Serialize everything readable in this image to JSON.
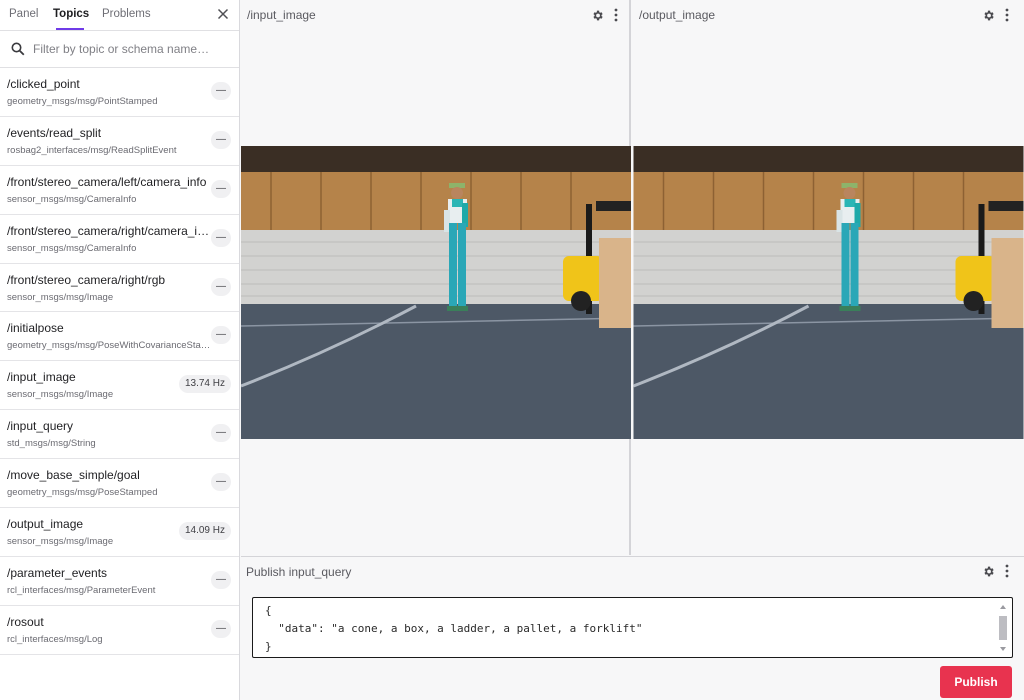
{
  "sidebar": {
    "tabs": [
      {
        "label": "Panel"
      },
      {
        "label": "Topics"
      },
      {
        "label": "Problems"
      }
    ],
    "filter_placeholder": "Filter by topic or schema name…",
    "topics": [
      {
        "name": "/clicked_point",
        "schema": "geometry_msgs/msg/PointStamped",
        "freq": "—"
      },
      {
        "name": "/events/read_split",
        "schema": "rosbag2_interfaces/msg/ReadSplitEvent",
        "freq": "—"
      },
      {
        "name": "/front/stereo_camera/left/camera_info",
        "schema": "sensor_msgs/msg/CameraInfo",
        "freq": "—"
      },
      {
        "name": "/front/stereo_camera/right/camera_info",
        "schema": "sensor_msgs/msg/CameraInfo",
        "freq": "—"
      },
      {
        "name": "/front/stereo_camera/right/rgb",
        "schema": "sensor_msgs/msg/Image",
        "freq": "—"
      },
      {
        "name": "/initialpose",
        "schema": "geometry_msgs/msg/PoseWithCovarianceStamped",
        "freq": "—"
      },
      {
        "name": "/input_image",
        "schema": "sensor_msgs/msg/Image",
        "freq": "13.74 Hz"
      },
      {
        "name": "/input_query",
        "schema": "std_msgs/msg/String",
        "freq": "—"
      },
      {
        "name": "/move_base_simple/goal",
        "schema": "geometry_msgs/msg/PoseStamped",
        "freq": "—"
      },
      {
        "name": "/output_image",
        "schema": "sensor_msgs/msg/Image",
        "freq": "14.09 Hz"
      },
      {
        "name": "/parameter_events",
        "schema": "rcl_interfaces/msg/ParameterEvent",
        "freq": "—"
      },
      {
        "name": "/rosout",
        "schema": "rcl_interfaces/msg/Log",
        "freq": "—"
      }
    ]
  },
  "panels": {
    "input": {
      "title": "/input_image"
    },
    "output": {
      "title": "/output_image"
    }
  },
  "publish": {
    "title": "Publish input_query",
    "editor_lines": [
      "{",
      "  \"data\": \"a cone, a box, a ladder, a pallet, a forklift\"",
      "}"
    ],
    "button_label": "Publish"
  },
  "colors": {
    "accent": "#6f3be8",
    "publish_button": "#e8334f"
  }
}
